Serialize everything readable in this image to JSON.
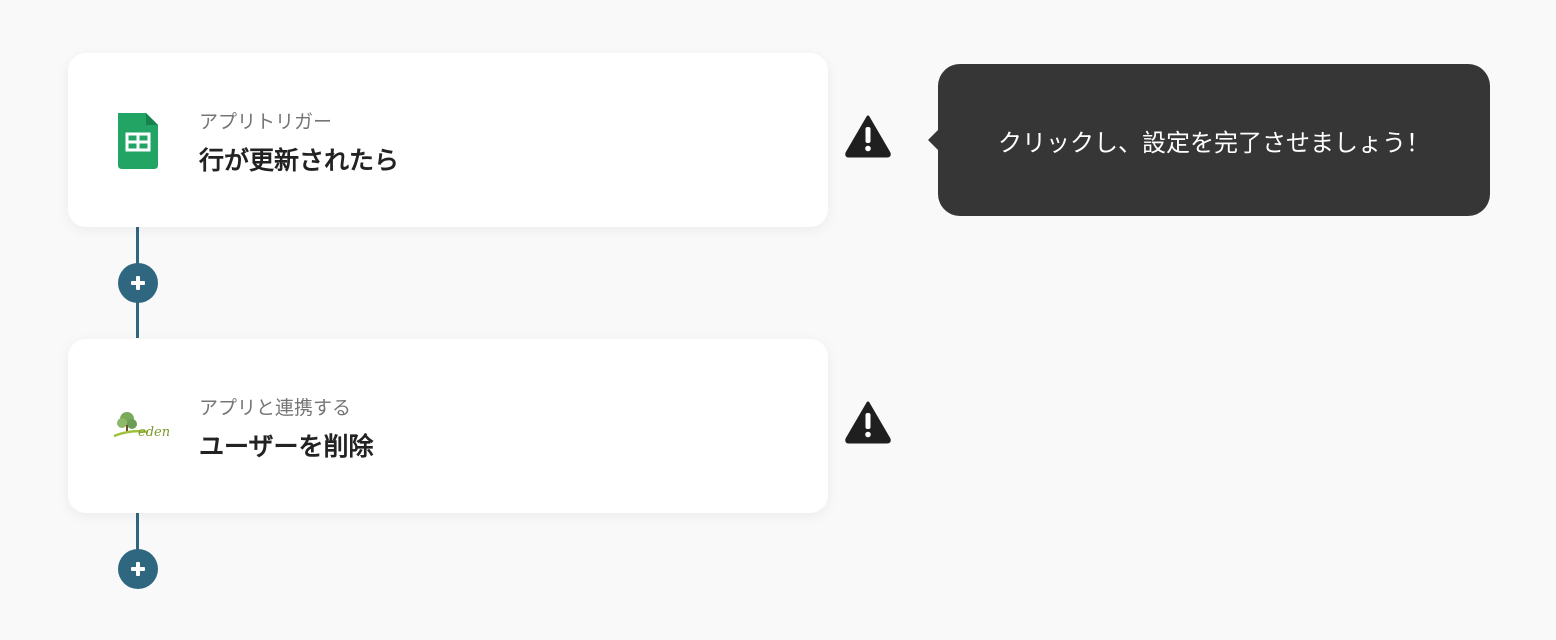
{
  "steps": [
    {
      "subtitle": "アプリトリガー",
      "title": "行が更新されたら",
      "icon": "google-sheets-icon"
    },
    {
      "subtitle": "アプリと連携する",
      "title": "ユーザーを削除",
      "icon": "eden-logo-icon",
      "logo_text": "eden"
    }
  ],
  "tooltip": {
    "text": "クリックし、設定を完了させましょう！"
  },
  "icons": {
    "warning": "warning-icon",
    "add": "plus-icon"
  },
  "colors": {
    "connector": "#2f6780",
    "tooltip_bg": "#363636",
    "sheets_green": "#21a464",
    "warning": "#1f1f1f"
  }
}
